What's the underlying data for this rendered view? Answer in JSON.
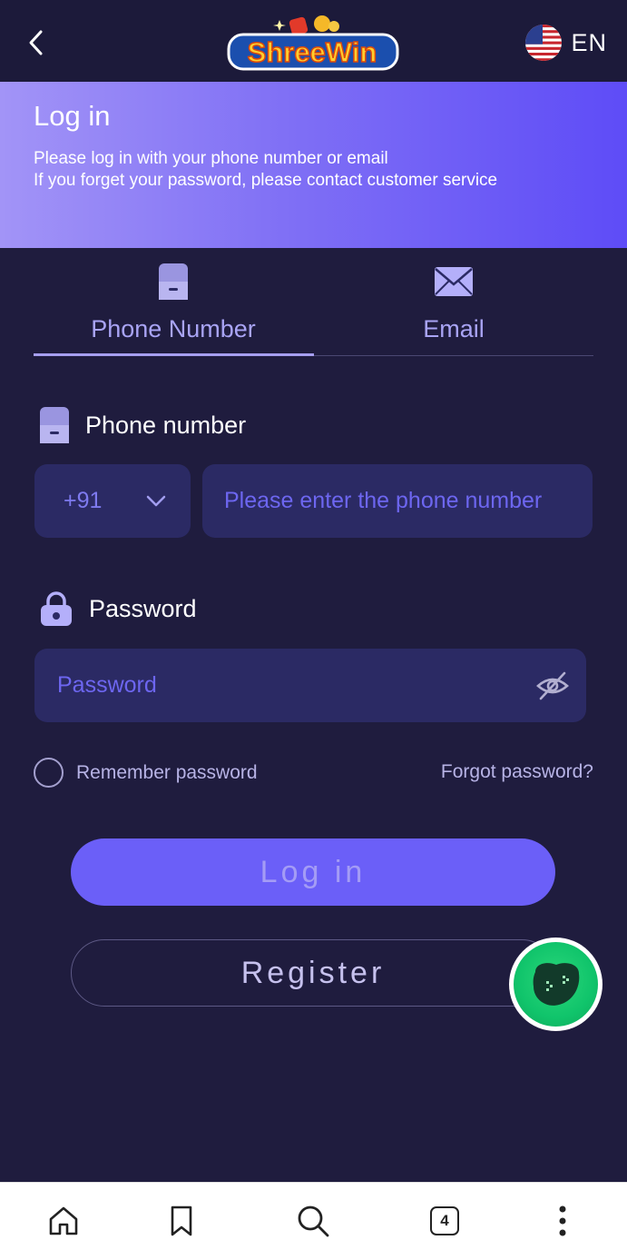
{
  "header": {
    "logo_text": "ShreeWin",
    "language": "EN",
    "flag": "us-flag-icon",
    "back_icon": "chevron-left-icon"
  },
  "hero": {
    "title": "Log in",
    "line1": "Please log in with your phone number or email",
    "line2": "If you forget your password, please contact customer service"
  },
  "tabs": [
    {
      "label": "Phone Number",
      "icon": "phone-icon",
      "active": true
    },
    {
      "label": "Email",
      "icon": "mail-icon",
      "active": false
    }
  ],
  "phone": {
    "label": "Phone number",
    "country_code": "+91",
    "placeholder": "Please enter the phone number"
  },
  "password": {
    "label": "Password",
    "placeholder": "Password"
  },
  "options": {
    "remember_label": "Remember password",
    "forgot_label": "Forgot password?"
  },
  "buttons": {
    "login_label": "Log in",
    "register_label": "Register"
  },
  "bottom_nav": {
    "items": [
      "home-icon",
      "bookmark-icon",
      "search-icon",
      "tabs-icon",
      "more-icon"
    ],
    "tab_count": "4"
  },
  "colors": {
    "background": "#1f1c3e",
    "accent": "#6b5ff8",
    "input_bg": "#2b2a64",
    "placeholder": "#6d66f0"
  }
}
